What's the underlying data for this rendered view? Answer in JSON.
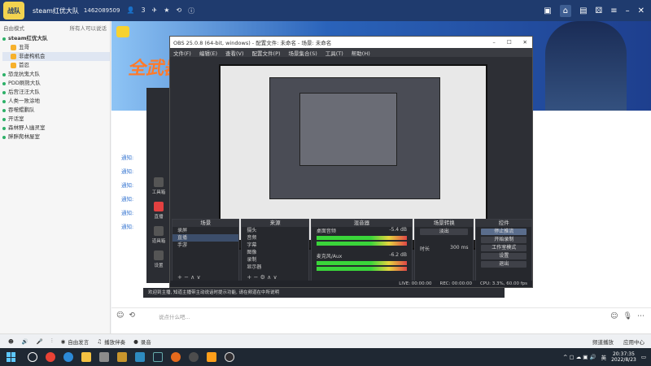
{
  "topbar": {
    "logo": "战队",
    "title": "steam红优大队",
    "id": "1462089509",
    "people": "3",
    "icons": [
      "user-icon",
      "flag-icon",
      "share-icon",
      "info-icon"
    ],
    "right_icons": [
      "screen-icon",
      "home-icon",
      "inbox-icon",
      "game-icon",
      "menu-icon",
      "minimize-icon",
      "close-icon"
    ]
  },
  "left": {
    "mode": "自由模式",
    "placeholder_right": "所有人可以说话",
    "tree": [
      {
        "label": "steam红优大队",
        "level": 0,
        "bold": true
      },
      {
        "label": "丑哥",
        "level": 1
      },
      {
        "label": "非虚构机会",
        "level": 1,
        "selected": true
      },
      {
        "label": "首忍",
        "level": 1
      },
      {
        "label": "恐龙抗鬼大队",
        "level": 0
      },
      {
        "label": "PDD刷熊大队",
        "level": 0
      },
      {
        "label": "后宫汪汪大队",
        "level": 0
      },
      {
        "label": "人类一败涂地",
        "level": 0
      },
      {
        "label": "吞噬鲲鹏队",
        "level": 0
      },
      {
        "label": "开话室",
        "level": 0
      },
      {
        "label": "森林野人幽灵室",
        "level": 0
      },
      {
        "label": "胖胖爬林屋室",
        "level": 0
      }
    ]
  },
  "banner": {
    "text": "全武器"
  },
  "messages": [
    {
      "label": "通知:",
      "text": ""
    },
    {
      "label": "通知:",
      "text": ""
    },
    {
      "label": "通知:",
      "text": ""
    },
    {
      "label": "通知:",
      "text": ""
    },
    {
      "label": "通知:",
      "text": ""
    },
    {
      "label": "通知:",
      "text": ""
    }
  ],
  "appside": [
    "工具箱",
    "直播",
    "道具箱",
    "设置"
  ],
  "obs": {
    "title": "OBS 25.0.8 (64-bit, windows) - 配置文件: 未命名 - 场景: 未命名",
    "menu": [
      "文件(F)",
      "编辑(E)",
      "查看(V)",
      "配置文件(P)",
      "场景集合(S)",
      "工具(T)",
      "帮助(H)"
    ],
    "docks": {
      "scenes": {
        "title": "场景",
        "items": [
          "录屏",
          "直播",
          "手游"
        ],
        "selected": 1
      },
      "sources": {
        "title": "来源",
        "items": [
          "摄头",
          "音频",
          "字幕",
          "图像",
          "录制",
          "显示器"
        ]
      },
      "mixer": {
        "title": "混音器",
        "rows": [
          {
            "name": "桌面音频",
            "value": "-5.4 dB"
          },
          {
            "name": "麦克风/Aux",
            "value": "-6.2 dB"
          }
        ]
      },
      "transitions": {
        "title": "场景转换",
        "selected": "淡出",
        "duration_label": "时长",
        "duration": "300 ms"
      },
      "controls": {
        "title": "控件",
        "buttons": [
          "停止推流",
          "开始录制",
          "工作室模式",
          "设置",
          "退出"
        ],
        "active": 0
      }
    },
    "status": {
      "live": "LIVE: 00:00:00",
      "rec": "REC: 00:00:00",
      "cpu": "CPU: 3.3%, 60.00 fps"
    }
  },
  "notice": "欢迎到主播, 知道主播带主动说话时提示功能, 请在频道在中所说明",
  "input": {
    "placeholder": "说点什么吧..."
  },
  "botbar": {
    "items": [
      "自由发言",
      "播放伴奏",
      "录音"
    ],
    "right": [
      "频道播放",
      "应用中心"
    ]
  },
  "taskbar": {
    "time": "20:37:35",
    "date": "2022/8/23",
    "lang": "英"
  }
}
